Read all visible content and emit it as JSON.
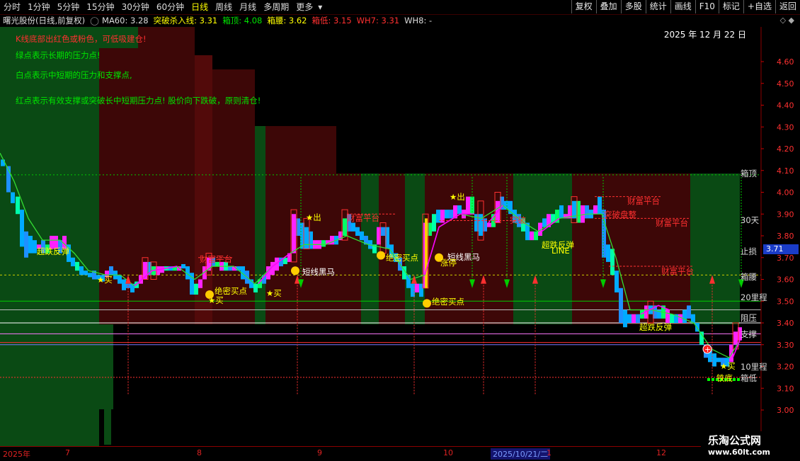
{
  "toolbar": {
    "periods": [
      "分时",
      "1分钟",
      "5分钟",
      "15分钟",
      "30分钟",
      "60分钟",
      "日线",
      "周线",
      "月线",
      "多周期",
      "更多"
    ],
    "active_period": "日线",
    "dropdown_indicator": "▾",
    "right_buttons": [
      "复权",
      "叠加",
      "多股",
      "统计",
      "画线",
      "F10",
      "标记",
      "+自选",
      "返回"
    ]
  },
  "info": {
    "stock": "曙光股份(日线,前复权)",
    "ma60": "MA60: 3.28",
    "breakout": "突破杀入线: 3.31",
    "box_top": "箱顶: 4.08",
    "box_waist": "箱腰: 3.62",
    "box_low": "箱低: 3.15",
    "wh7": "WH7: 3.31",
    "wh8": "WH8: -"
  },
  "notes": {
    "n1": "K线底部出红色或粉色，可低吸建仓!",
    "n2": "绿点表示长期的压力点!",
    "n3": "白点表示中短期的压力和支撑点,",
    "n4": "红点表示有效支撑或突破长中短期压力点! 股价向下跌破，原则清仓!"
  },
  "date": "2025 年 12 月 22 日",
  "last_price": "3.71",
  "y_ticks": [
    "4.60",
    "4.50",
    "4.40",
    "4.30",
    "4.20",
    "4.10",
    "4.00",
    "3.90",
    "3.80",
    "3.70",
    "3.60",
    "3.50",
    "3.40",
    "3.30",
    "3.20",
    "3.10",
    "3.00"
  ],
  "x_labels": [
    "2025年",
    "7",
    "8",
    "9",
    "10",
    "2025/10/21/二",
    "1",
    "12"
  ],
  "right_labels": {
    "box_top": "箱顶",
    "days30": "30天",
    "stop_loss": "止损",
    "box_waist": "箱腰",
    "li20": "20里程",
    "resist": "阻压",
    "support": "支撑",
    "li10": "10里程",
    "box_low": "箱低"
  },
  "signals": {
    "buy": "★买",
    "rebound": "超跌反弹",
    "secret_buy": "绝密买点",
    "wealth_platform": "财富平台",
    "short_dark_horse": "短线黑马",
    "out": "★出",
    "bottom": "铁底",
    "break_box": "突破盘整",
    "line": "LINE",
    "limit_up": "涨停",
    "breakthrough": "突破"
  },
  "colors": {
    "accent_yellow": "#ffff00",
    "up_candle": "#ff00ff",
    "down_candle": "#00aaff",
    "green_bg": "#0a4a14",
    "red_bg": "#4a0808"
  },
  "watermark": {
    "title": "乐淘公式网",
    "url": "www.60lt.com"
  }
}
